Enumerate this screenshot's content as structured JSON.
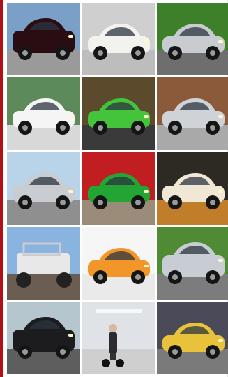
{
  "gallery": {
    "columns": 3,
    "rows": 5,
    "tiles": [
      {
        "subject": "dark-red-minivan",
        "bg": "#7aa0c8",
        "ground": "#9a9a9a",
        "car": "#2a0d12"
      },
      {
        "subject": "white-two-seat-microcar",
        "bg": "#cfcfcf",
        "ground": "#bdbdbd",
        "car": "#f2f2ee"
      },
      {
        "subject": "silver-sports-coupe",
        "bg": "#3e7f2a",
        "ground": "#6e6e6e",
        "car": "#c8cbcf"
      },
      {
        "subject": "white-sedan-in-motion",
        "bg": "#5d8a5a",
        "ground": "#d8d8d8",
        "car": "#f5f5f5"
      },
      {
        "subject": "green-concept-car-front",
        "bg": "#5b4a2c",
        "ground": "#3a3a3a",
        "car": "#44c43a"
      },
      {
        "subject": "silver-hatchback",
        "bg": "#8a5a3a",
        "ground": "#a9a9a9",
        "car": "#cfd2d6"
      },
      {
        "subject": "silver-sedan-parking-lot",
        "bg": "#b9d4e8",
        "ground": "#8f8f8f",
        "car": "#c9ccd0"
      },
      {
        "subject": "green-hatchback-showroom",
        "bg": "#c11e22",
        "ground": "#9b8c7a",
        "car": "#23a534"
      },
      {
        "subject": "cream-coupe-showroom",
        "bg": "#2d2a24",
        "ground": "#c07d2a",
        "car": "#f1e7d5"
      },
      {
        "subject": "white-off-road-buggy",
        "bg": "#8ab4e0",
        "ground": "#6b5d52",
        "car": "#e8e8e8"
      },
      {
        "subject": "orange-concept-coupe",
        "bg": "#f6f6f6",
        "ground": "#eaeaea",
        "car": "#f3962a"
      },
      {
        "subject": "silver-suv",
        "bg": "#4f8a34",
        "ground": "#7c7c7c",
        "car": "#c7cdd2"
      },
      {
        "subject": "black-suv",
        "bg": "#b6c6cf",
        "ground": "#5e5e5e",
        "car": "#1c1c1e"
      },
      {
        "subject": "person-on-segway",
        "bg": "#dfe3e8",
        "ground": "#cfcfcf",
        "car": "#2c2c30"
      },
      {
        "subject": "yellow-taxi-city-street",
        "bg": "#4a4a58",
        "ground": "#7a7a7a",
        "car": "#e8c23a"
      }
    ]
  }
}
